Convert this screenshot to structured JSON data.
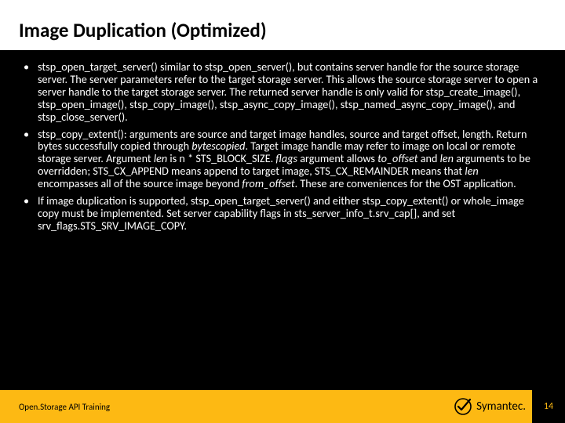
{
  "title": "Image Duplication (Optimized)",
  "bullets": {
    "b1": {
      "t1": "stsp_open_target_server() similar to stsp_open_server(), but contains server handle for the source storage server. The server parameters refer to the target storage server. This allows the source storage server to open a server handle to the target storage server. The returned server handle is only valid for stsp_create_image(), stsp_open_image(), stsp_copy_image(), stsp_async_copy_image(), stsp_named_async_copy_image(), and stsp_close_server()."
    },
    "b2": {
      "t1": "stsp_copy_extent(): arguments are source and target image handles, source and target offset, length. Return bytes successfully copied through ",
      "i1": "bytescopied",
      "t2": ". Target image handle may refer to image on local or remote storage server. Argument ",
      "i2": "len",
      "t3": " is n * STS_BLOCK_SIZE. ",
      "i3": "flags",
      "t4": " argument allows ",
      "i4": "to_offset",
      "t5": " and ",
      "i5": "len",
      "t6": " arguments to be overridden; STS_CX_APPEND means append to target image, STS_CX_REMAINDER means that ",
      "i6": "len",
      "t7": " encompasses all of the source image beyond ",
      "i7": "from_offset",
      "t8": ". These are conveniences for the OST application."
    },
    "b3": {
      "t1": "If image duplication is supported, stsp_open_target_server() and either stsp_copy_extent() or whole_image copy must be implemented. Set server capability flags in sts_server_info_t.srv_cap[], and set srv_flags.STS_SRV_IMAGE_COPY."
    }
  },
  "footer": {
    "label": "Open.Storage API Training",
    "brand": "Symantec.",
    "page": "14"
  }
}
